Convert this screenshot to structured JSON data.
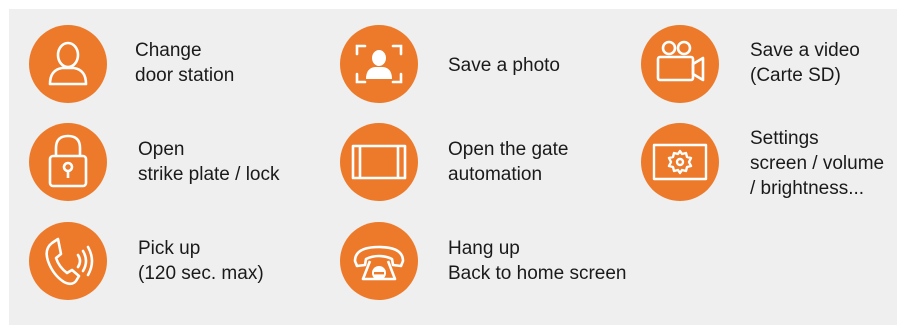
{
  "colors": {
    "accent": "#ec7a2a",
    "accent_dark": "#d9661a",
    "background": "#efefef",
    "text": "#1a1a1a"
  },
  "items": [
    {
      "icon": "person-icon",
      "lines": [
        "Change",
        "door station"
      ]
    },
    {
      "icon": "photo-capture-icon",
      "lines": [
        "Save a photo"
      ]
    },
    {
      "icon": "video-camera-icon",
      "lines": [
        "Save a video",
        "(Carte SD)"
      ]
    },
    {
      "icon": "padlock-icon",
      "lines": [
        "Open",
        "strike plate / lock"
      ]
    },
    {
      "icon": "gate-icon",
      "lines": [
        "Open the gate",
        "automation"
      ]
    },
    {
      "icon": "settings-screen-icon",
      "lines": [
        "Settings",
        "screen / volume",
        "/ brightness..."
      ]
    },
    {
      "icon": "phone-pickup-icon",
      "lines": [
        "Pick up",
        "(120 sec. max)"
      ]
    },
    {
      "icon": "hang-up-icon",
      "lines": [
        "Hang up",
        "Back to home screen"
      ]
    }
  ]
}
